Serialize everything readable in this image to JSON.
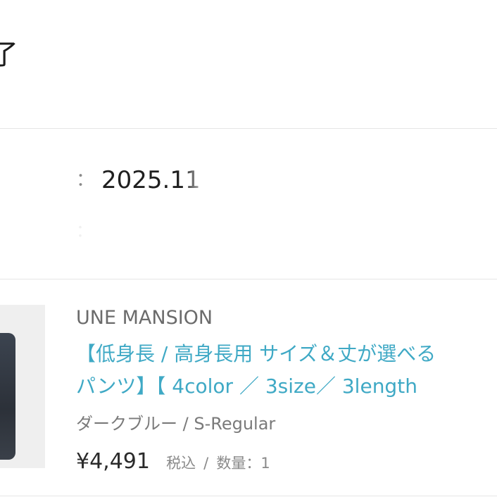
{
  "header": {
    "status_title": "了"
  },
  "order_info": {
    "colon": "：",
    "order_date": "2025.11"
  },
  "product": {
    "brand": "UNE MANSION",
    "title_line1": "【低身長 / 高身長用 サイズ＆丈が選べる",
    "title_line2": "パンツ】【 4color ／ 3size／ 3length",
    "variant": "ダークブルー / S-Regular",
    "price": "¥4,491",
    "tax_label": "税込",
    "separator": "/",
    "quantity_label": "数量：1"
  }
}
